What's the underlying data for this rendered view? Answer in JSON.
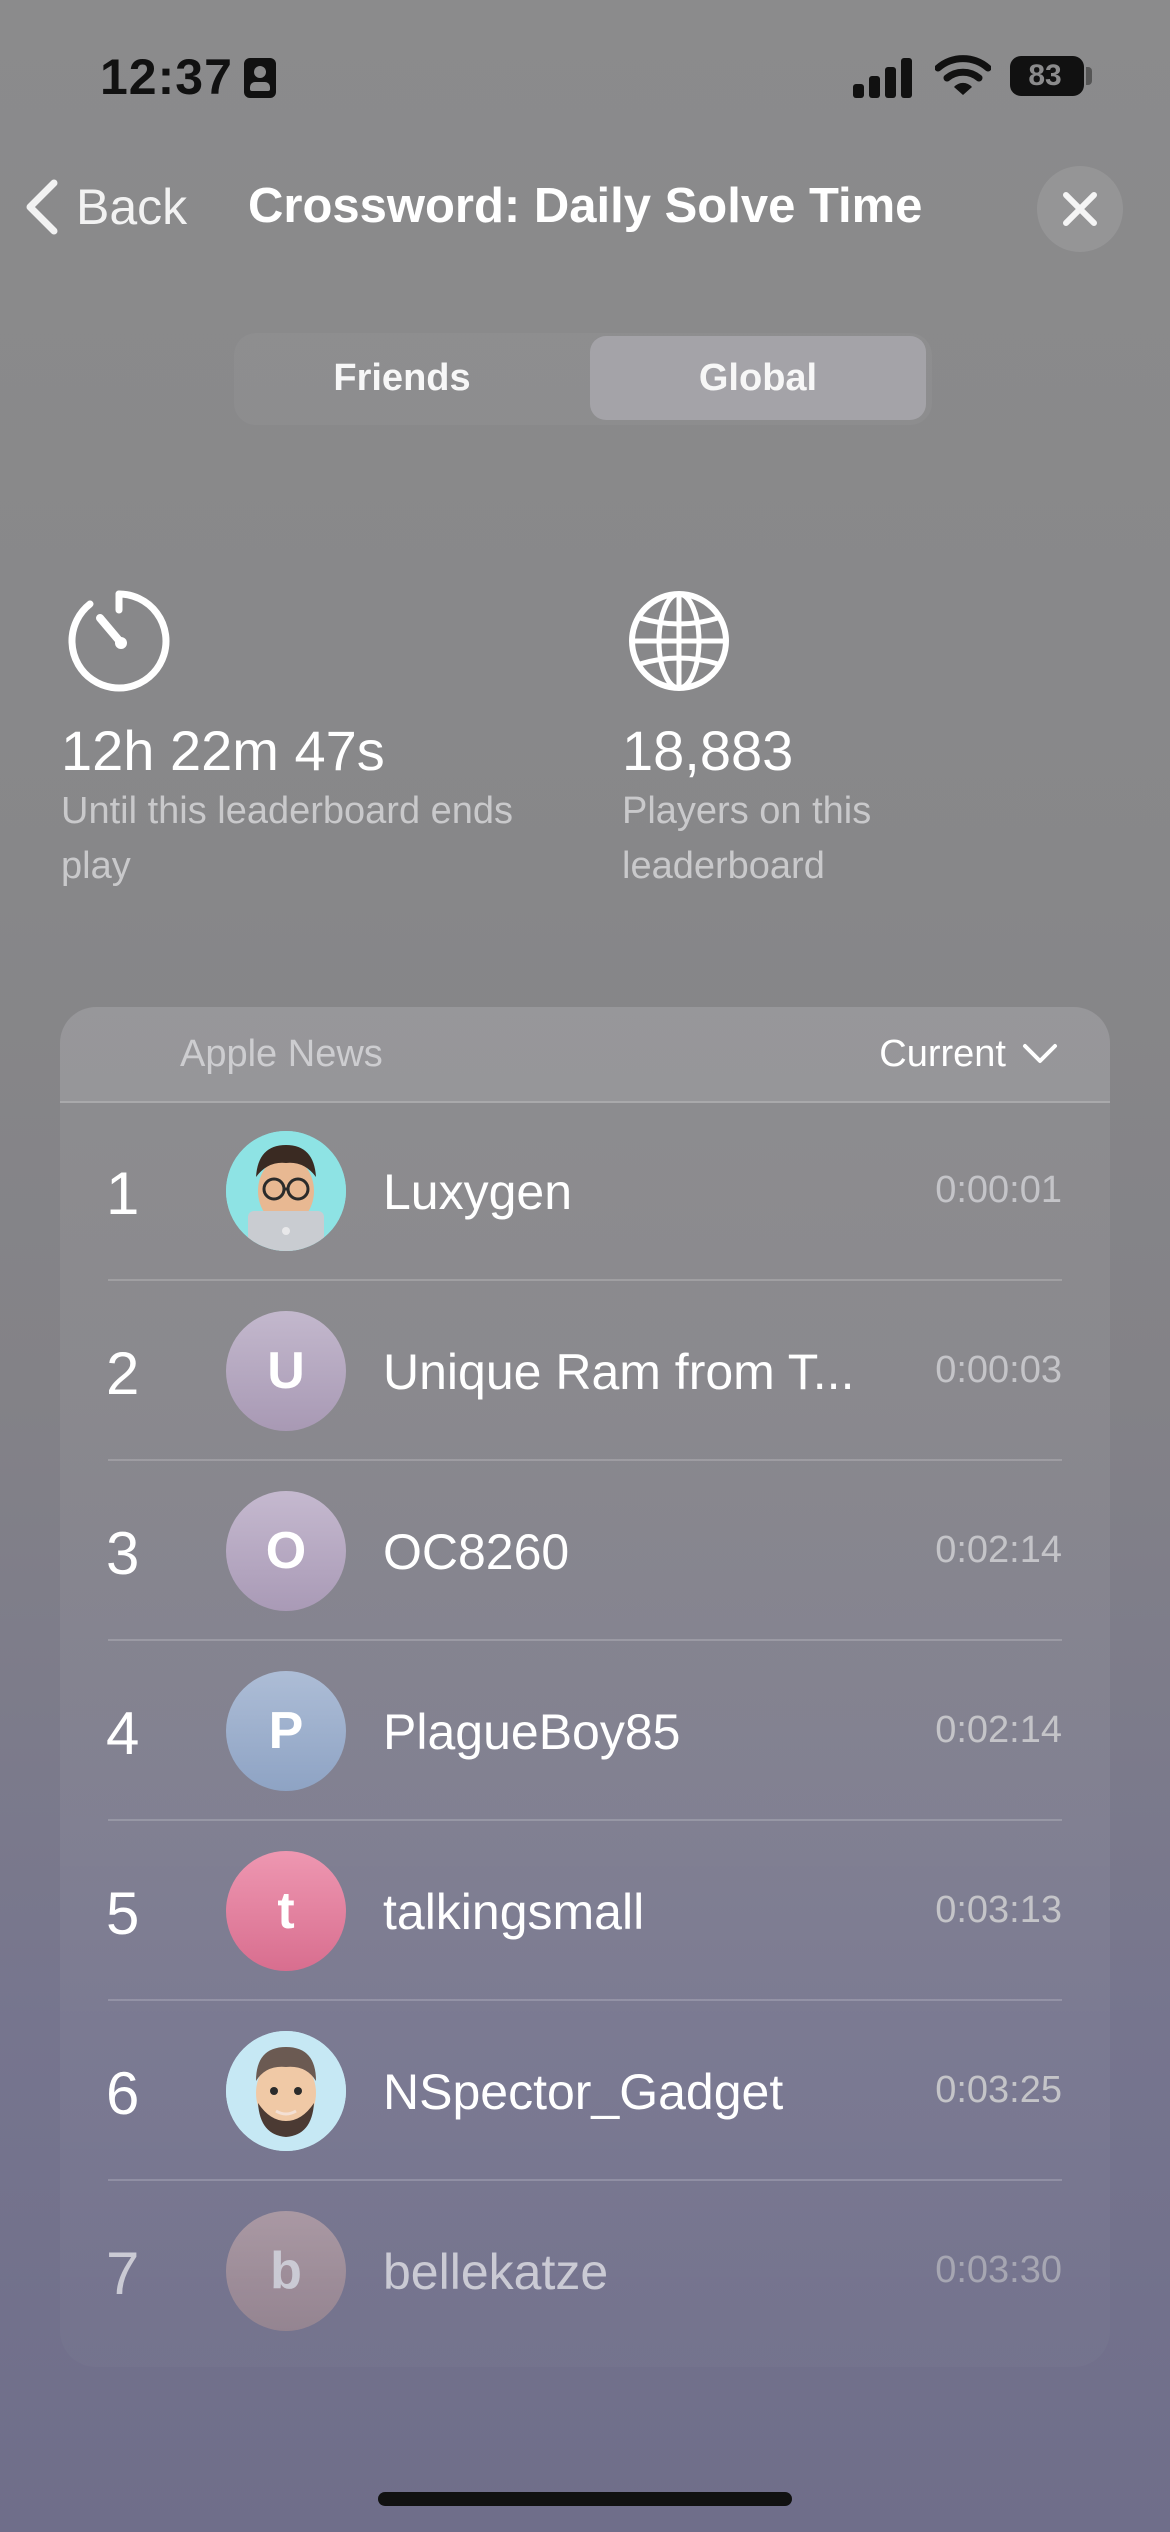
{
  "status": {
    "time": "12:37",
    "battery": "83"
  },
  "nav": {
    "back_label": "Back",
    "title": "Crossword: Daily Solve Time"
  },
  "segments": {
    "friends": "Friends",
    "global": "Global",
    "selected": "Global"
  },
  "stats": {
    "time_left": {
      "icon": "timer-icon",
      "value": "12h 22m 47s",
      "label": "Until this leaderboard ends play"
    },
    "players": {
      "icon": "globe-icon",
      "value": "18,883",
      "label": "Players on this leaderboard"
    }
  },
  "leaderboard": {
    "source": "Apple News",
    "filter": "Current",
    "rows": [
      {
        "rank": "1",
        "name": "Luxygen",
        "time": "0:00:01",
        "avatar": {
          "type": "memoji",
          "initial": ""
        }
      },
      {
        "rank": "2",
        "name": "Unique Ram from T...",
        "time": "0:00:03",
        "avatar": {
          "type": "initial",
          "initial": "U",
          "color": "#b8adc3"
        }
      },
      {
        "rank": "3",
        "name": "OC8260",
        "time": "0:02:14",
        "avatar": {
          "type": "initial",
          "initial": "O",
          "color": "#b9adc4"
        }
      },
      {
        "rank": "4",
        "name": "PlagueBoy85",
        "time": "0:02:14",
        "avatar": {
          "type": "initial",
          "initial": "P",
          "color": "#9eb0cc"
        }
      },
      {
        "rank": "5",
        "name": "talkingsmall",
        "time": "0:03:13",
        "avatar": {
          "type": "initial",
          "initial": "t",
          "color": "#df7f9c"
        }
      },
      {
        "rank": "6",
        "name": "NSpector_Gadget",
        "time": "0:03:25",
        "avatar": {
          "type": "memoji",
          "initial": ""
        }
      },
      {
        "rank": "7",
        "name": "bellekatze",
        "time": "0:03:30",
        "avatar": {
          "type": "initial",
          "initial": "b",
          "color": "#b59ea1"
        }
      }
    ]
  }
}
